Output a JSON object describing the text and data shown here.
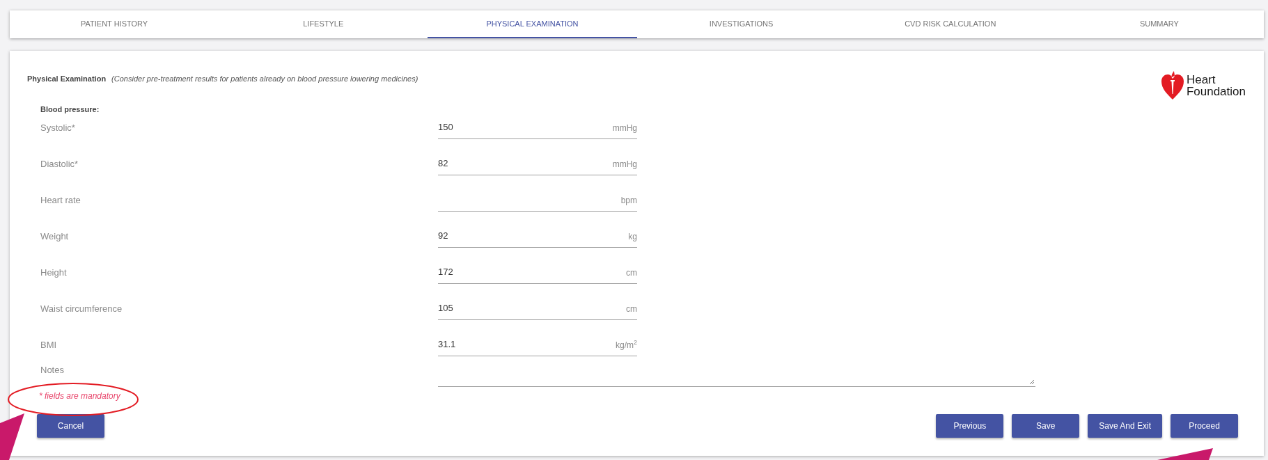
{
  "tabs": [
    {
      "label": "PATIENT HISTORY",
      "selected": false
    },
    {
      "label": "LIFESTYLE",
      "selected": false
    },
    {
      "label": "PHYSICAL EXAMINATION",
      "selected": true
    },
    {
      "label": "INVESTIGATIONS",
      "selected": false
    },
    {
      "label": "CVD RISK CALCULATION",
      "selected": false
    },
    {
      "label": "SUMMARY",
      "selected": false
    }
  ],
  "section": {
    "title": "Physical Examination",
    "note": "(Consider pre-treatment results for patients already on blood pressure lowering medicines)"
  },
  "logo": {
    "lines": [
      "Heart",
      "Foundation"
    ]
  },
  "group_label": "Blood pressure:",
  "fields": [
    {
      "label": "Systolic*",
      "value": "150",
      "unit": "mmHg"
    },
    {
      "label": "Diastolic*",
      "value": "82",
      "unit": "mmHg"
    },
    {
      "label": "Heart rate",
      "unit": "bpm"
    },
    {
      "label": "Weight",
      "value": "92",
      "unit": "kg"
    },
    {
      "label": "Height",
      "value": "172",
      "unit": "cm"
    },
    {
      "label": "Waist circumference",
      "value": "105",
      "unit": "cm"
    },
    {
      "label": "BMI",
      "value": "31.1",
      "unit": "kg/m$^{2}$"
    }
  ],
  "notes": {
    "label": "Notes"
  },
  "mandatory_note": "* fields are mandatory",
  "left_buttons": [
    "Cancel"
  ],
  "right_buttons": [
    "Previous",
    "Save",
    "Save And Exit",
    "Proceed"
  ]
}
